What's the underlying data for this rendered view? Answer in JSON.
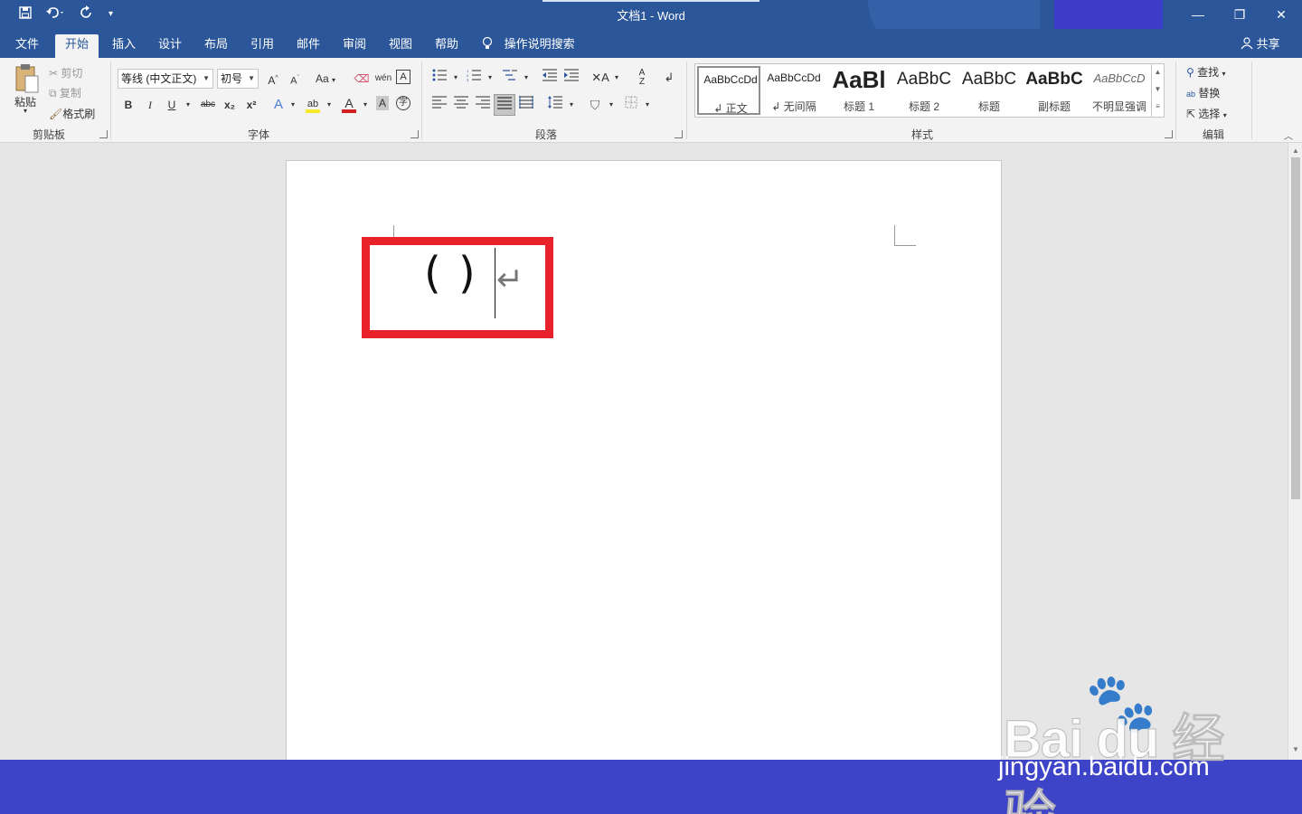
{
  "titlebar": {
    "title": "文档1  -  Word",
    "quick_access": {
      "save": "save-icon",
      "undo": "undo-icon",
      "redo": "redo-icon",
      "customize": "▾"
    },
    "window_controls": {
      "minimize": "—",
      "restore": "❐",
      "close": "✕"
    }
  },
  "menu": {
    "tabs": [
      "文件",
      "开始",
      "插入",
      "设计",
      "布局",
      "引用",
      "邮件",
      "审阅",
      "视图",
      "帮助"
    ],
    "active_tab": "开始",
    "tell_me": "操作说明搜索",
    "share": "共享"
  },
  "ribbon": {
    "clipboard": {
      "label": "剪贴板",
      "paste": "粘贴",
      "cut": "剪切",
      "copy": "复制",
      "format_painter": "格式刷"
    },
    "font": {
      "label": "字体",
      "font_name": "等线 (中文正文)",
      "font_size": "初号",
      "grow": "A",
      "shrink": "A",
      "change_case": "Aa",
      "bold": "B",
      "italic": "I",
      "underline": "U",
      "strike": "abc",
      "subscript": "x₂",
      "superscript": "x²"
    },
    "paragraph": {
      "label": "段落"
    },
    "styles": {
      "label": "样式",
      "items": [
        {
          "sample": "AaBbCcDd",
          "name": "↲ 正文"
        },
        {
          "sample": "AaBbCcDd",
          "name": "↲ 无间隔"
        },
        {
          "sample": "AaBl",
          "name": "标题 1"
        },
        {
          "sample": "AaBbC",
          "name": "标题 2"
        },
        {
          "sample": "AaBbC",
          "name": "标题"
        },
        {
          "sample": "AaBbC",
          "name": "副标题"
        },
        {
          "sample": "AaBbCcD",
          "name": "不明显强调"
        }
      ]
    },
    "editing": {
      "label": "编辑",
      "find": "查找",
      "replace": "替换",
      "select": "选择"
    }
  },
  "document": {
    "text": "( )",
    "paragraph_mark": "↵"
  },
  "watermark": {
    "logo": "Bai du 经验",
    "site": "jingyan.baidu.com"
  },
  "colors": {
    "title_bar": "#2b579a",
    "ribbon_bg": "#f3f3f3",
    "highlight_border": "#e8212a",
    "bottom_band": "#3e44c8"
  }
}
